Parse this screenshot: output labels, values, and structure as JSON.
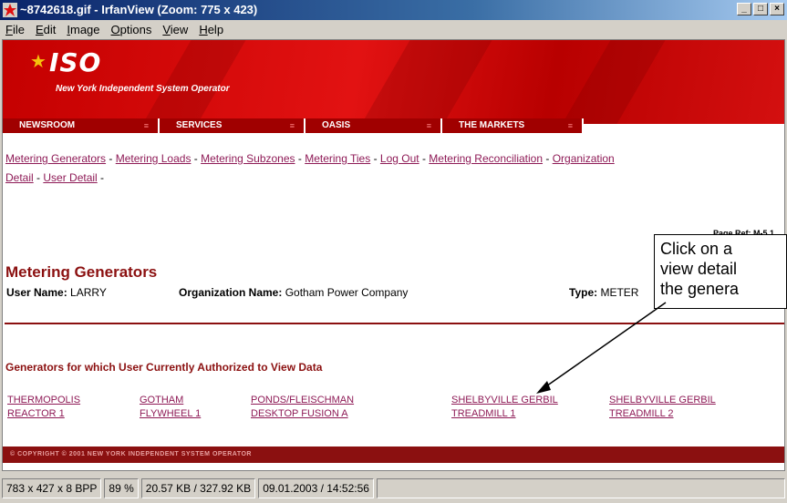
{
  "window": {
    "title": "~8742618.gif - IrfanView (Zoom: 775 x 423)",
    "controls": {
      "minimize": "_",
      "maximize": "□",
      "close": "×"
    }
  },
  "menu": [
    "File",
    "Edit",
    "Image",
    "Options",
    "View",
    "Help"
  ],
  "page": {
    "logo_text": "ISO",
    "tagline": "New York Independent System Operator",
    "nav_tabs": [
      "NEWSROOM",
      "SERVICES",
      "OASIS",
      "THE MARKETS"
    ],
    "links_line1": [
      "Metering Generators",
      "Metering Loads",
      "Metering Subzones",
      "Metering Ties",
      "Log Out",
      "Metering Reconciliation",
      "Organization"
    ],
    "links_line2": [
      "Detail",
      "User Detail"
    ],
    "separator": " - ",
    "page_ref": "Page Ref: M-5.1",
    "title": "Metering Generators",
    "user_label": "User Name:",
    "user_value": "LARRY",
    "org_label": "Organization Name:",
    "org_value": "Gotham Power Company",
    "type_label": "Type:",
    "type_value": "METER",
    "generators_heading": "Generators for which User Currently Authorized to View Data",
    "generators": [
      {
        "line1": "THERMOPOLIS",
        "line2": "REACTOR 1"
      },
      {
        "line1": "GOTHAM",
        "line2": "FLYWHEEL 1"
      },
      {
        "line1": "PONDS/FLEISCHMAN",
        "line2": "DESKTOP FUSION A"
      },
      {
        "line1": "SHELBYVILLE GERBIL",
        "line2": "TREADMILL 1"
      },
      {
        "line1": "SHELBYVILLE GERBIL",
        "line2": "TREADMILL 2"
      }
    ],
    "footer": "© COPYRIGHT © 2001 NEW YORK INDEPENDENT SYSTEM OPERATOR"
  },
  "callout": {
    "line1": "Click on a",
    "line2": "view detail",
    "line3": "the genera"
  },
  "status": [
    "783 x 427 x 8 BPP",
    "89 %",
    "20.57 KB / 327.92 KB",
    "09.01.2003 / 14:52:56"
  ],
  "colors": {
    "banner_red": "#d41010",
    "link_purple": "#8e1a56",
    "heading_red": "#8b1010"
  }
}
